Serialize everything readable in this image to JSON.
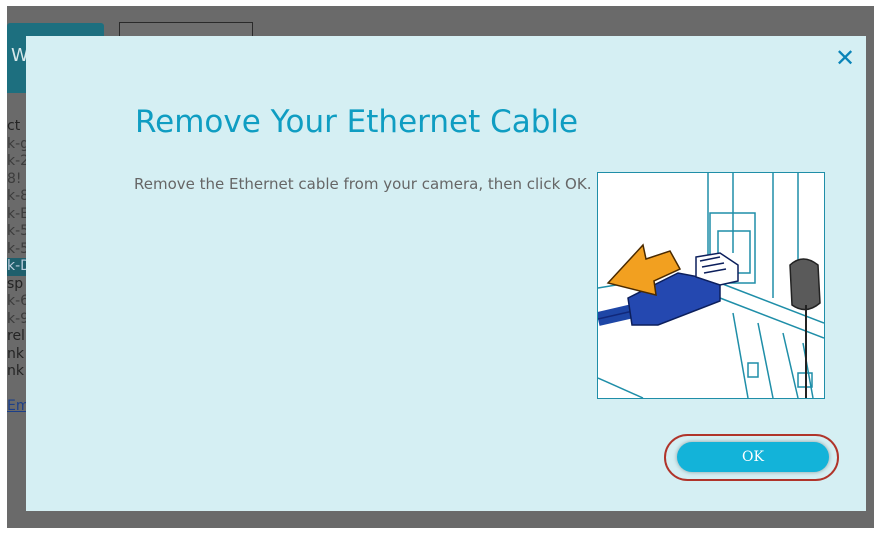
{
  "background": {
    "tab_text": "W",
    "list_items": [
      {
        "text": "ct",
        "style": "dk"
      },
      {
        "text": "k-g",
        "style": ""
      },
      {
        "text": "k-2",
        "style": ""
      },
      {
        "text": "8!",
        "style": ""
      },
      {
        "text": "k-8",
        "style": ""
      },
      {
        "text": "k-E",
        "style": ""
      },
      {
        "text": "k-5",
        "style": ""
      },
      {
        "text": "k-5",
        "style": ""
      },
      {
        "text": "k-D",
        "style": "hl"
      },
      {
        "text": "sp",
        "style": "dk"
      },
      {
        "text": "k-6",
        "style": ""
      },
      {
        "text": "k-9",
        "style": ""
      },
      {
        "text": "rel",
        "style": "dk"
      },
      {
        "text": "nk",
        "style": "dk"
      },
      {
        "text": "nk",
        "style": "dk"
      },
      {
        "text": "",
        "style": ""
      },
      {
        "text": "Em",
        "style": "lnk"
      }
    ]
  },
  "modal": {
    "title": "Remove Your Ethernet Cable",
    "description": "Remove the Ethernet cable from your camera, then click OK.",
    "close_icon": "close-icon",
    "ok_label": "OK",
    "illustration": "ethernet-cable-removal-illustration",
    "colors": {
      "background": "#d5eff3",
      "title": "#0f9dc2",
      "button": "#13b3d9",
      "highlight_ring": "#b0342a"
    }
  }
}
